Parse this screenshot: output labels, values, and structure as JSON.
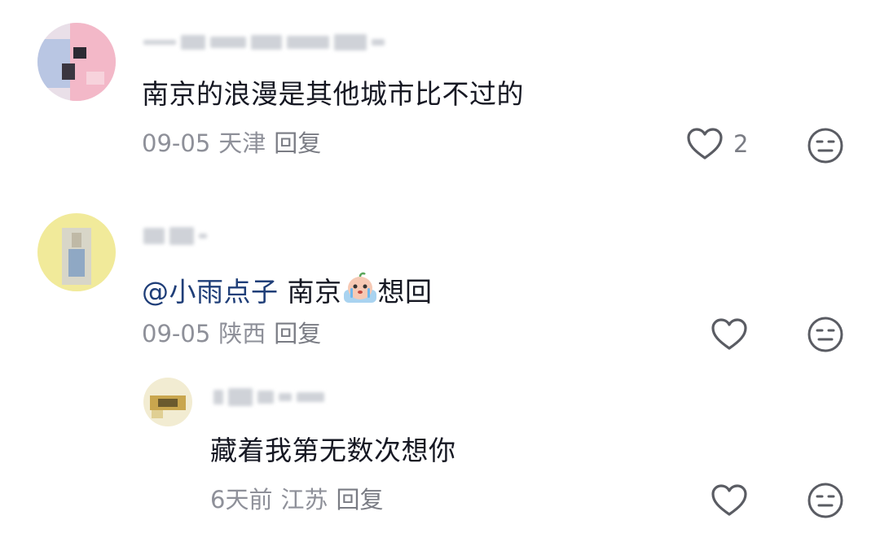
{
  "comments": [
    {
      "text": "南京的浪漫是其他城市比不过的",
      "date": "09-05",
      "location": "天津",
      "reply_label": "回复",
      "like_count": "2"
    },
    {
      "mention": "@小雨点子",
      "text_before_emoji": "南京",
      "text_after_emoji": "想回",
      "date": "09-05",
      "location": "陕西",
      "reply_label": "回复"
    },
    {
      "text": "藏着我第无数次想你",
      "date": "6天前",
      "location": "江苏",
      "reply_label": "回复"
    }
  ],
  "colors": {
    "mention": "#1f3e78",
    "meta": "#8e9099",
    "icon": "#5a5c63"
  },
  "icons": [
    "heart-icon",
    "neutral-face-icon",
    "crying-emoji"
  ]
}
